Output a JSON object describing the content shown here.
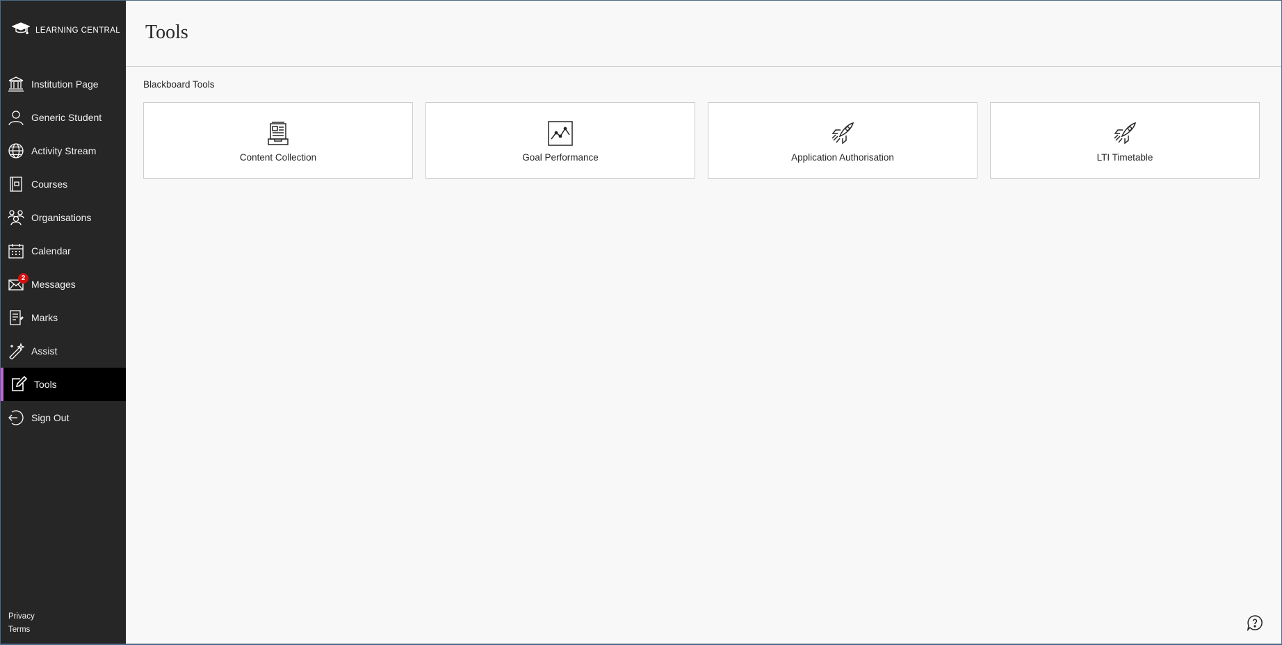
{
  "brand": {
    "name": "LEARNING CENTRAL",
    "icon": "graduation-cap-icon"
  },
  "sidebar": {
    "items": [
      {
        "label": "Institution Page",
        "icon": "institution-icon"
      },
      {
        "label": "Generic Student",
        "icon": "user-icon"
      },
      {
        "label": "Activity Stream",
        "icon": "globe-icon"
      },
      {
        "label": "Courses",
        "icon": "courses-icon"
      },
      {
        "label": "Organisations",
        "icon": "organisations-icon"
      },
      {
        "label": "Calendar",
        "icon": "calendar-icon"
      },
      {
        "label": "Messages",
        "icon": "envelope-icon",
        "badge": "2"
      },
      {
        "label": "Marks",
        "icon": "marks-icon"
      },
      {
        "label": "Assist",
        "icon": "assist-icon"
      },
      {
        "label": "Tools",
        "icon": "tools-icon",
        "active": true
      },
      {
        "label": "Sign Out",
        "icon": "sign-out-icon"
      }
    ],
    "footer": {
      "privacy": "Privacy",
      "terms": "Terms"
    }
  },
  "main": {
    "title": "Tools",
    "section_title": "Blackboard Tools",
    "cards": [
      {
        "label": "Content Collection",
        "icon": "content-collection-icon"
      },
      {
        "label": "Goal Performance",
        "icon": "chart-icon"
      },
      {
        "label": "Application Authorisation",
        "icon": "rocket-icon"
      },
      {
        "label": "LTI Timetable",
        "icon": "rocket-icon"
      }
    ]
  },
  "help": {
    "icon": "help-icon"
  },
  "colors": {
    "sidebar_bg": "#262626",
    "active_bg": "#000000",
    "active_accent": "#c561d8",
    "badge": "#d40f0f",
    "content_bg": "#f8f8f8"
  }
}
